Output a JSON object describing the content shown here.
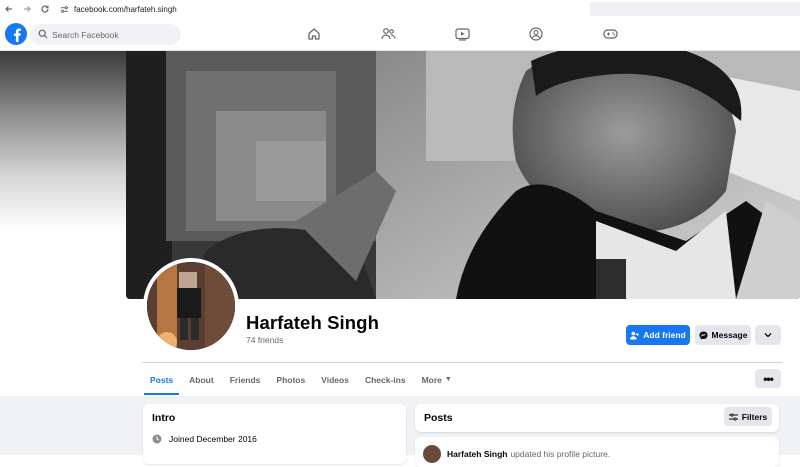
{
  "browser": {
    "url": "facebook.com/harfateh.singh",
    "back_icon": "back-arrow-icon",
    "forward_icon": "forward-arrow-icon",
    "reload_icon": "reload-icon"
  },
  "topbar": {
    "logo": "facebook-logo-icon",
    "search_placeholder": "Search Facebook",
    "nav_icons": [
      "home-icon",
      "friends-icon",
      "video-icon",
      "groups-icon",
      "gaming-icon"
    ],
    "accent_color": "#1877f2"
  },
  "profile": {
    "name": "Harfateh Singh",
    "friends_count": "74 friends",
    "buttons": {
      "add_friend": "Add friend",
      "message": "Message"
    }
  },
  "tabs": [
    {
      "label": "Posts",
      "active": true
    },
    {
      "label": "About",
      "active": false
    },
    {
      "label": "Friends",
      "active": false
    },
    {
      "label": "Photos",
      "active": false
    },
    {
      "label": "Videos",
      "active": false
    },
    {
      "label": "Check-ins",
      "active": false
    },
    {
      "label": "More",
      "active": false
    }
  ],
  "intro": {
    "title": "Intro",
    "joined": "Joined December 2016"
  },
  "posts": {
    "title": "Posts",
    "filters_label": "Filters",
    "first_post": {
      "author": "Harfateh Singh",
      "action": "updated his profile picture."
    }
  }
}
